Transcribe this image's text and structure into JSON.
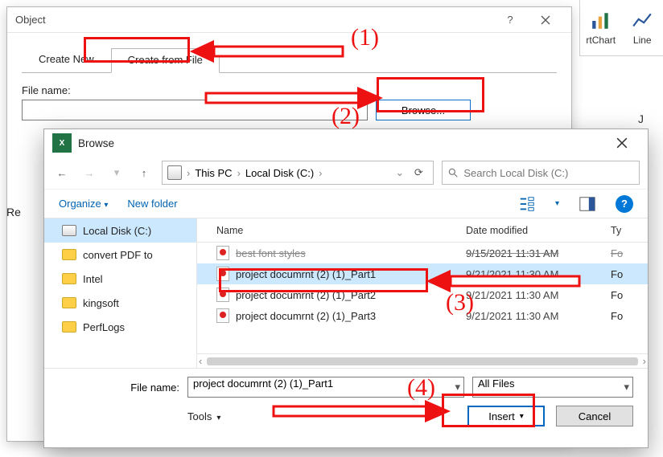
{
  "object_dialog": {
    "title": "Object",
    "tab_create_new": "Create New",
    "tab_create_from_file": "Create from File",
    "file_name_label": "File name:",
    "file_name_value": "",
    "browse_label": "Browse..."
  },
  "ribbon": {
    "pivotchart": "rtChart",
    "line": "Line"
  },
  "column_header": "J",
  "fragment_re": "Re",
  "browse_dialog": {
    "title": "Browse",
    "path": {
      "root": "This PC",
      "drive": "Local Disk (C:)"
    },
    "search_placeholder": "Search Local Disk (C:)",
    "toolbar": {
      "organize": "Organize",
      "new_folder": "New folder"
    },
    "sidebar": {
      "items": [
        {
          "label": "Local Disk (C:)",
          "kind": "drive",
          "selected": true
        },
        {
          "label": "convert PDF to",
          "kind": "folder"
        },
        {
          "label": "Intel",
          "kind": "folder"
        },
        {
          "label": "kingsoft",
          "kind": "folder"
        },
        {
          "label": "PerfLogs",
          "kind": "folder"
        }
      ]
    },
    "columns": {
      "name": "Name",
      "date": "Date modified",
      "type": "Ty"
    },
    "rows": [
      {
        "name": "best font styles",
        "date": "9/15/2021 11:31 AM",
        "ty": "Fo",
        "selected": false,
        "cut": true
      },
      {
        "name": "project documrnt (2) (1)_Part1",
        "date": "9/21/2021 11:30 AM",
        "ty": "Fo",
        "selected": true
      },
      {
        "name": "project documrnt (2) (1)_Part2",
        "date": "9/21/2021 11:30 AM",
        "ty": "Fo"
      },
      {
        "name": "project documrnt (2) (1)_Part3",
        "date": "9/21/2021 11:30 AM",
        "ty": "Fo"
      }
    ],
    "file_name_label": "File name:",
    "file_name_value": "project documrnt (2) (1)_Part1",
    "filter_value": "All Files",
    "tools_label": "Tools",
    "insert_label": "Insert",
    "cancel_label": "Cancel"
  },
  "annot": {
    "a1": "(1)",
    "a2": "(2)",
    "a3": "(3)",
    "a4": "(4)"
  }
}
